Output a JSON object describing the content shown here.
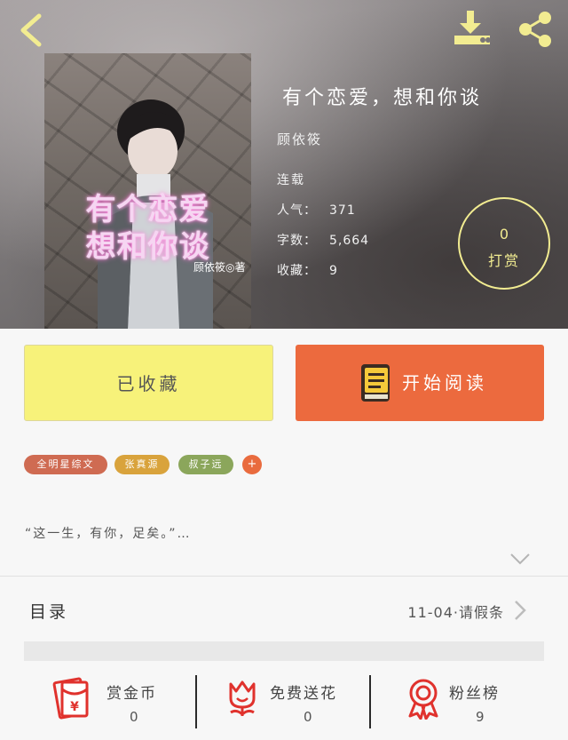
{
  "header": {
    "back_icon": "chevron-left-icon",
    "download_icon": "download-icon",
    "share_icon": "share-icon"
  },
  "cover": {
    "title_line1": "有个恋爱",
    "title_line2": "想和你谈",
    "author_mark": "顾依筱◎著"
  },
  "book": {
    "title": "有个恋爱，想和你谈",
    "author": "顾依筱",
    "status": "连载",
    "popularity_label": "人气：",
    "popularity_value": "371",
    "words_label": "字数：",
    "words_value": "5,664",
    "favorites_label": "收藏：",
    "favorites_value": "9"
  },
  "tip": {
    "count": "0",
    "label": "打赏"
  },
  "actions": {
    "collected_label": "已收藏",
    "read_label": "开始阅读"
  },
  "tags": [
    "全明星综文",
    "张真源",
    "叔子远",
    "+"
  ],
  "synopsis": "“这一生，有你，足矣。”…",
  "toc": {
    "label": "目录",
    "latest": "11-04·请假条"
  },
  "bottom": {
    "reward": {
      "label": "赏金币",
      "count": "0"
    },
    "flowers": {
      "label": "免费送花",
      "count": "0"
    },
    "fans": {
      "label": "粉丝榜",
      "count": "9"
    }
  },
  "colors": {
    "accent_yellow": "#f7f27a",
    "accent_orange": "#ec6a3e",
    "icon_red": "#e0322d",
    "tip_ring": "#f2ec91"
  }
}
